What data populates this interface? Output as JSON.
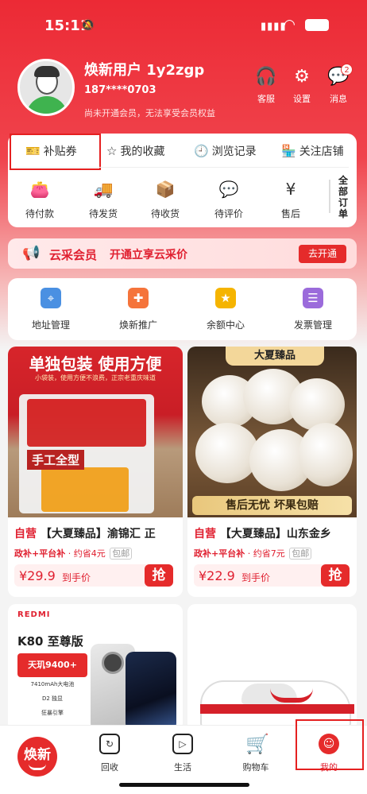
{
  "status": {
    "time": "15:11"
  },
  "profile": {
    "name": "焕新用户 1y2zgp",
    "phone": "187****0703",
    "member_text": "尚未开通会员，无法享受会员权益"
  },
  "header_icons": [
    {
      "label": "客服",
      "icon": "headset-icon"
    },
    {
      "label": "设置",
      "icon": "gear-icon"
    },
    {
      "label": "消息",
      "icon": "message-icon",
      "badge": "2"
    }
  ],
  "quick_tabs": [
    {
      "label": "补贴券",
      "icon": "coupon-icon"
    },
    {
      "label": "我的收藏",
      "icon": "star-icon"
    },
    {
      "label": "浏览记录",
      "icon": "history-icon"
    },
    {
      "label": "关注店铺",
      "icon": "store-icon"
    }
  ],
  "orders": [
    {
      "label": "待付款",
      "icon": "wallet-icon"
    },
    {
      "label": "待发货",
      "icon": "truck-icon"
    },
    {
      "label": "待收货",
      "icon": "package-icon"
    },
    {
      "label": "待评价",
      "icon": "comment-icon"
    },
    {
      "label": "售后",
      "icon": "refund-icon"
    }
  ],
  "all_orders": "全部订单",
  "membership": {
    "title": "云采会员",
    "desc": "开通立享云采价",
    "button": "去开通"
  },
  "services": [
    {
      "label": "地址管理",
      "icon": "location-icon",
      "color": "#4a90e2"
    },
    {
      "label": "焕新推广",
      "icon": "user-plus-icon",
      "color": "#f5743b"
    },
    {
      "label": "余额中心",
      "icon": "coin-icon",
      "color": "#f5b400"
    },
    {
      "label": "发票管理",
      "icon": "invoice-icon",
      "color": "#9b6bdb"
    }
  ],
  "products": [
    {
      "img_heading": "单独包装 使用方便",
      "img_sub": "小袋装，使用方便不浪费，正宗老重庆味道",
      "img_label": "手工全型",
      "self_op": "自营",
      "title": "【大夏臻品】渝锦汇 正",
      "tag_a": "政补+平台补",
      "tag_b": "· 约省4元",
      "tag_c": "包邮",
      "price": "¥29.9",
      "price_suffix": "到手价",
      "buy": "抢"
    },
    {
      "img_brand": "大夏臻品",
      "img_foot": "售后无忧 坏果包赔",
      "self_op": "自营",
      "title": "【大夏臻品】山东金乡",
      "tag_a": "政补+平台补",
      "tag_b": "· 约省7元",
      "tag_c": "包邮",
      "price": "¥22.9",
      "price_suffix": "到手价",
      "buy": "抢"
    }
  ],
  "promo_phone": {
    "brand": "REDMI",
    "model": "K80 至尊版",
    "chip": "天玑9400+",
    "specs": [
      "7410mAh大电池",
      "D2 独显",
      "狂暴引擎"
    ]
  },
  "tabbar": {
    "logo": "焕新",
    "items": [
      {
        "label": "回收",
        "icon": "recycle-icon"
      },
      {
        "label": "生活",
        "icon": "play-icon"
      },
      {
        "label": "购物车",
        "icon": "cart-icon"
      },
      {
        "label": "我的",
        "icon": "face-icon"
      }
    ]
  }
}
